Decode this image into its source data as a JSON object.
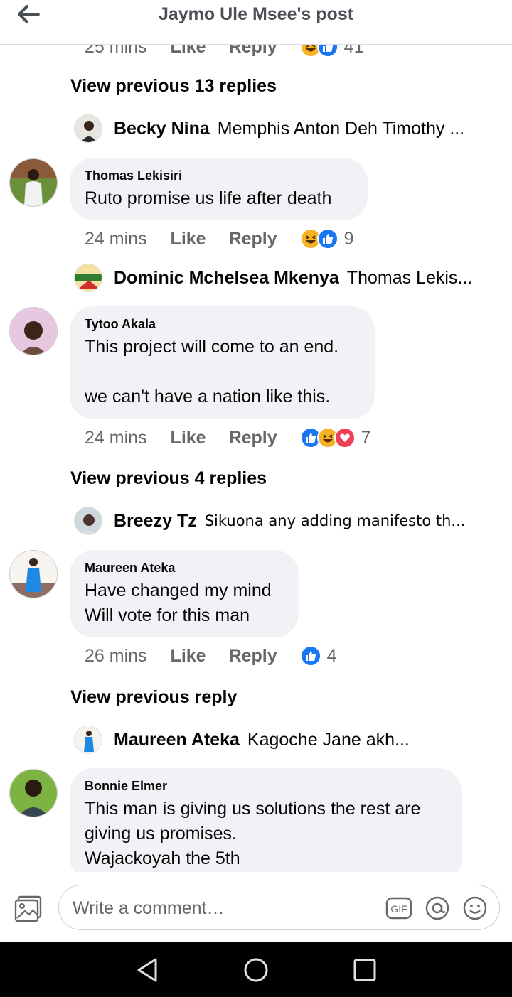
{
  "header": {
    "title": "Jaymo Ule Msee's post"
  },
  "top_partial": {
    "time": "25 mins",
    "like": "Like",
    "reply": "Reply",
    "count": "41"
  },
  "threads": [
    {
      "view_previous": "View previous 13 replies",
      "last_reply": {
        "name": "Becky Nina",
        "text": "Memphis Anton Deh Timothy ..."
      },
      "comment": {
        "name": "Thomas Lekisiri",
        "text": "Ruto promise us life after death"
      },
      "meta": {
        "time": "24 mins",
        "like": "Like",
        "reply": "Reply",
        "count": "9"
      }
    },
    {
      "last_reply": {
        "name": "Dominic Mchelsea Mkenya",
        "text": "Thomas Lekis..."
      },
      "comment": {
        "name": "Tytoo Akala",
        "text": "This project will come to an end.\n\nwe can't have a nation like this."
      },
      "meta": {
        "time": "24 mins",
        "like": "Like",
        "reply": "Reply",
        "count": "7"
      }
    },
    {
      "view_previous": "View previous 4 replies",
      "last_reply": {
        "name": "Breezy Tz",
        "text": "Sikuona any adding manifesto th..."
      },
      "comment": {
        "name": "Maureen Ateka",
        "text": "Have changed my mind\nWill vote for this man"
      },
      "meta": {
        "time": "26 mins",
        "like": "Like",
        "reply": "Reply",
        "count": "4"
      }
    },
    {
      "view_previous": "View previous reply",
      "last_reply": {
        "name": "Maureen Ateka",
        "text": "Kagoche Jane akh..."
      },
      "comment": {
        "name": "Bonnie Elmer",
        "text": "This man is giving us solutions the rest are\ngiving us promises.\nWajackoyah the 5th"
      }
    }
  ],
  "composer": {
    "placeholder": "Write a comment…"
  },
  "colors": {
    "like": "#1877f2",
    "haha": "#f7b125",
    "love": "#f33e58",
    "bubble": "#f0f2f5",
    "muted": "#65676b"
  },
  "icons": [
    "back-arrow-icon",
    "photo-icon",
    "gif-icon",
    "at-icon",
    "smile-icon",
    "like-reaction-icon",
    "haha-reaction-icon",
    "love-reaction-icon",
    "nav-back-icon",
    "nav-home-icon",
    "nav-recents-icon"
  ]
}
